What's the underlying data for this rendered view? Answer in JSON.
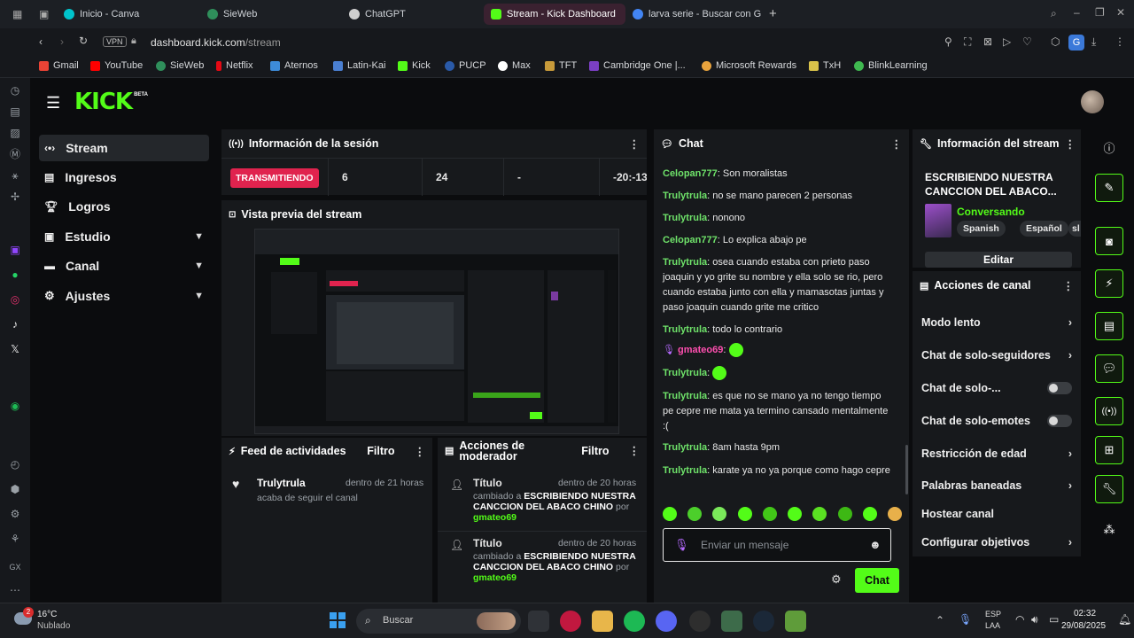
{
  "browser": {
    "tabs": [
      {
        "label": "Inicio - Canva",
        "icon": "canva-icon",
        "color": "#00c4cc"
      },
      {
        "label": "SieWeb",
        "icon": "sieweb-icon",
        "color": "#2f8f5b"
      },
      {
        "label": "ChatGPT",
        "icon": "chatgpt-icon",
        "color": "#cfcfcf"
      },
      {
        "label": "Stream - Kick Dashboard",
        "icon": "kick-icon",
        "color": "#53fc18"
      },
      {
        "label": "larva serie - Buscar con G",
        "icon": "google-icon",
        "color": "#4285f4"
      }
    ],
    "new_tab": "+",
    "vpn": "VPN",
    "url_host": "dashboard.kick.com",
    "url_path": "/stream",
    "bookmarks": [
      {
        "label": "Gmail",
        "color": "#ea4335"
      },
      {
        "label": "YouTube",
        "color": "#ff0000"
      },
      {
        "label": "SieWeb",
        "color": "#2f8f5b"
      },
      {
        "label": "Netflix",
        "color": "#e50914"
      },
      {
        "label": "Aternos",
        "color": "#3d8bd9"
      },
      {
        "label": "Latin-Kai",
        "color": "#4a7fd1"
      },
      {
        "label": "Kick",
        "color": "#53fc18"
      },
      {
        "label": "PUCP",
        "color": "#2a5aa8"
      },
      {
        "label": "Max",
        "color": "#ffffff"
      },
      {
        "label": "TFT",
        "color": "#c79a3a"
      },
      {
        "label": "Cambridge One |...",
        "color": "#7b3fc4"
      },
      {
        "label": "Microsoft Rewards",
        "color": "#e8a33d"
      },
      {
        "label": "TxH",
        "color": "#d9c24a"
      },
      {
        "label": "BlinkLearning",
        "color": "#3fb950"
      }
    ]
  },
  "kick": {
    "logo": "KICK",
    "logo_badge": "BETA",
    "nav": [
      {
        "label": "Stream",
        "icon": "stream-icon",
        "active": true,
        "chevron": false
      },
      {
        "label": "Ingresos",
        "icon": "wallet-icon",
        "active": false,
        "chevron": false
      },
      {
        "label": "Logros",
        "icon": "trophy-icon",
        "active": false,
        "chevron": false
      },
      {
        "label": "Estudio",
        "icon": "studio-icon",
        "active": false,
        "chevron": true
      },
      {
        "label": "Canal",
        "icon": "channel-icon",
        "active": false,
        "chevron": true
      },
      {
        "label": "Ajustes",
        "icon": "gear-icon",
        "active": false,
        "chevron": true
      }
    ],
    "session": {
      "title": "Información de la sesión",
      "status": "TRANSMITIENDO",
      "stats": [
        "6",
        "24",
        "-",
        "-20:-13"
      ]
    },
    "preview": {
      "title": "Vista previa del stream"
    },
    "activity": {
      "title": "Feed de actividades",
      "filter": "Filtro",
      "items": [
        {
          "user": "Trulytrula",
          "time": "dentro de 21 horas",
          "desc": "acaba de seguir el canal"
        }
      ]
    },
    "mod_actions": {
      "title": "Acciones de moderador",
      "filter": "Filtro",
      "items": [
        {
          "title": "Título",
          "time": "dentro de 20 horas",
          "prefix": "cambiado a ",
          "value": "ESCRIBIENDO NUESTRA CANCCION DEL ABACO CHINO",
          "by": " por ",
          "user": "gmateo69"
        },
        {
          "title": "Título",
          "time": "dentro de 20 horas",
          "prefix": "cambiado a ",
          "value": "ESCRIBIENDO NUESTRA CANCCION DEL ABACO CHINO",
          "by": " por ",
          "user": "gmateo69"
        }
      ]
    },
    "chat": {
      "title": "Chat",
      "messages": [
        {
          "user": "Celopan777",
          "text": "Son moralistas"
        },
        {
          "user": "Trulytrula",
          "text": "no se mano parecen 2 personas"
        },
        {
          "user": "Trulytrula",
          "text": "nonono"
        },
        {
          "user": "Celopan777",
          "text": "Lo explica abajo pe"
        },
        {
          "user": "Trulytrula",
          "text": "osea cuando estaba con prieto paso joaquin y yo grite su nombre y ella solo se rio, pero cuando estaba junto con ella y mamasotas juntas y paso joaquin cuando grite me critico"
        },
        {
          "user": "Trulytrula",
          "text": "todo lo contrario"
        },
        {
          "user": "gmateo69",
          "text": ""
        },
        {
          "user": "Trulytrula",
          "text": ""
        },
        {
          "user": "Trulytrula",
          "text": "es que no se mano ya no tengo tiempo pe cepre me mata ya termino cansado mentalmente :("
        },
        {
          "user": "Trulytrula",
          "text": "8am hasta 9pm"
        },
        {
          "user": "Trulytrula",
          "text": "karate ya no ya porque como hago cepre"
        }
      ],
      "input_placeholder": "Enviar un mensaje",
      "send_label": "Chat"
    },
    "stream_info": {
      "title": "Información del stream",
      "stream_title": "ESCRIBIENDO NUESTRA CANCCION DEL ABACO...",
      "category": "Conversando",
      "tags": [
        "Spanish",
        "Español",
        "sl"
      ],
      "edit": "Editar"
    },
    "channel_actions": {
      "title": "Acciones de canal",
      "items": [
        {
          "label": "Modo lento",
          "control": "chevron"
        },
        {
          "label": "Chat de solo-seguidores",
          "control": "chevron"
        },
        {
          "label": "Chat de solo-...",
          "control": "toggle"
        },
        {
          "label": "Chat de solo-emotes",
          "control": "toggle"
        },
        {
          "label": "Restricción de edad",
          "control": "chevron"
        },
        {
          "label": "Palabras baneadas",
          "control": "chevron"
        },
        {
          "label": "Hostear canal",
          "control": "none"
        },
        {
          "label": "Configurar objetivos",
          "control": "chevron"
        }
      ]
    }
  },
  "taskbar": {
    "weather_temp": "16°C",
    "weather_desc": "Nublado",
    "weather_badge": "2",
    "search": "Buscar",
    "lang_top": "ESP",
    "lang_bottom": "LAA",
    "time": "02:32",
    "date": "29/08/2025"
  }
}
